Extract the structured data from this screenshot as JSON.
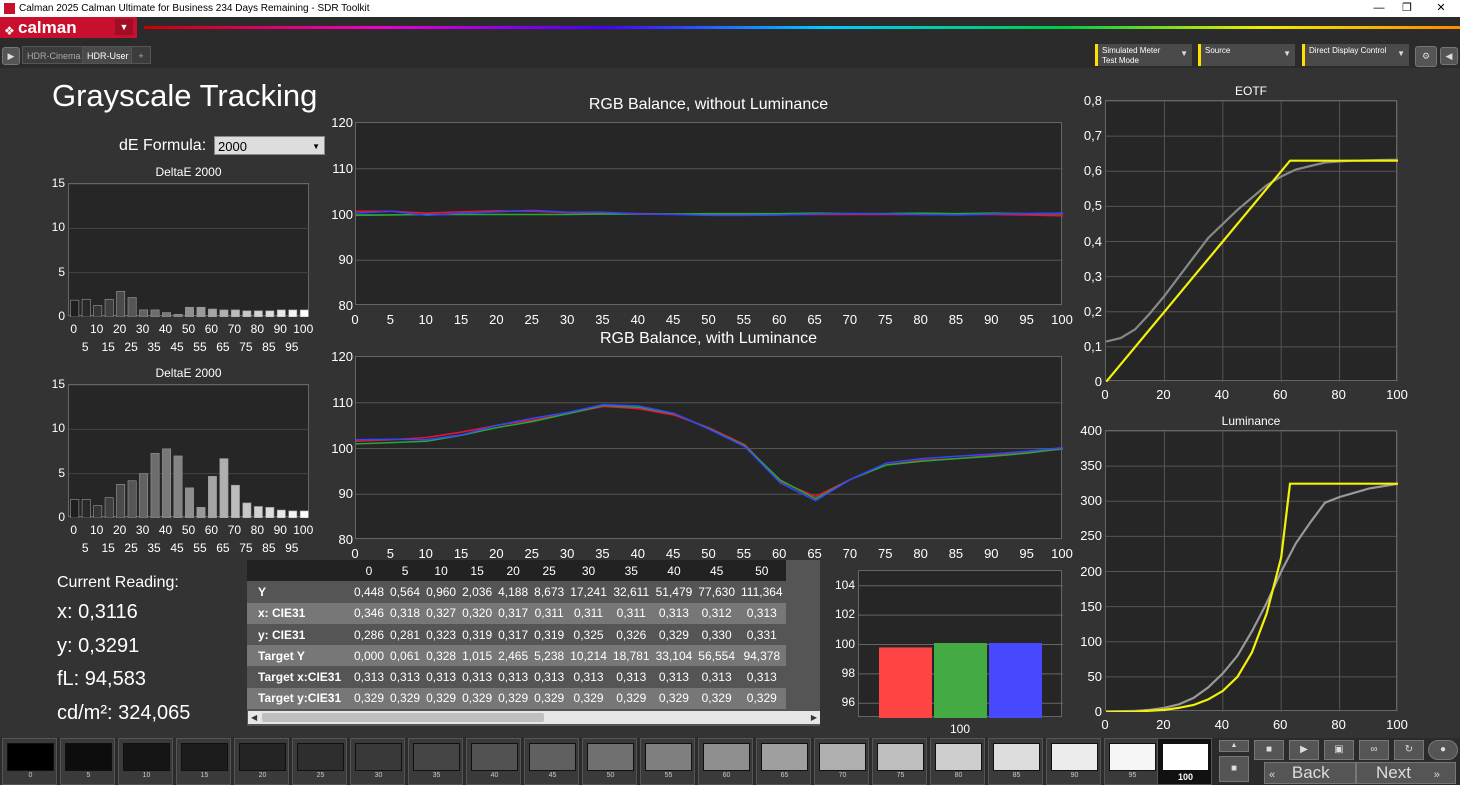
{
  "window": {
    "title": "Calman 2025 Calman Ultimate for Business 234 Days Remaining  - SDR Toolkit"
  },
  "brand": {
    "name": "calman"
  },
  "tabs": [
    {
      "label": "HDR-Cinema"
    },
    {
      "label": "HDR-User"
    },
    {
      "label": "+"
    }
  ],
  "toolbar": {
    "meter": {
      "line1": "Simulated Meter",
      "line2": "Test Mode"
    },
    "source": {
      "label": "Source"
    },
    "display": {
      "label": "Direct Display Control"
    }
  },
  "page": {
    "title": "Grayscale Tracking",
    "de_formula_label": "dE Formula:",
    "de_formula_value": "2000"
  },
  "reading": {
    "title": "Current Reading:",
    "x": "x: 0,3116",
    "y": "y: 0,3291",
    "fl": "fL: 94,583",
    "cdm2": "cd/m²: 324,065"
  },
  "chart_data": [
    {
      "type": "bar",
      "title": "DeltaE 2000",
      "x": [
        0,
        5,
        10,
        15,
        20,
        25,
        30,
        35,
        40,
        45,
        50,
        55,
        60,
        65,
        70,
        75,
        80,
        85,
        90,
        95,
        100
      ],
      "values": [
        1.9,
        2.0,
        1.3,
        2.0,
        2.9,
        2.2,
        0.8,
        0.8,
        0.5,
        0.3,
        1.1,
        1.1,
        0.9,
        0.8,
        0.8,
        0.7,
        0.7,
        0.7,
        0.8,
        0.8,
        0.8
      ],
      "ylim": [
        0,
        15
      ],
      "yticks": [
        0,
        5,
        10,
        15
      ],
      "xticks_top": [
        "0",
        "10",
        "20",
        "30",
        "40",
        "50",
        "60",
        "70",
        "80",
        "90",
        "100"
      ],
      "xticks_bottom": [
        "5",
        "15",
        "25",
        "35",
        "45",
        "55",
        "65",
        "75",
        "85",
        "95"
      ]
    },
    {
      "type": "bar",
      "title": "DeltaE 2000",
      "x": [
        0,
        5,
        10,
        15,
        20,
        25,
        30,
        35,
        40,
        45,
        50,
        55,
        60,
        65,
        70,
        75,
        80,
        85,
        90,
        95,
        100
      ],
      "values": [
        2.1,
        2.1,
        1.4,
        2.3,
        3.8,
        4.2,
        5.0,
        7.3,
        7.8,
        7.0,
        3.4,
        1.2,
        4.7,
        6.7,
        3.7,
        1.7,
        1.3,
        1.2,
        0.9,
        0.8,
        0.8
      ],
      "ylim": [
        0,
        15
      ],
      "yticks": [
        0,
        5,
        10,
        15
      ],
      "xticks_top": [
        "0",
        "10",
        "20",
        "30",
        "40",
        "50",
        "60",
        "70",
        "80",
        "90",
        "100"
      ],
      "xticks_bottom": [
        "5",
        "15",
        "25",
        "35",
        "45",
        "55",
        "65",
        "75",
        "85",
        "95"
      ]
    },
    {
      "type": "line",
      "title": "RGB Balance, without Luminance",
      "x": [
        0,
        5,
        10,
        15,
        20,
        25,
        30,
        35,
        40,
        45,
        50,
        55,
        60,
        65,
        70,
        75,
        80,
        85,
        90,
        95,
        100
      ],
      "series": [
        {
          "color": "#ee1133",
          "values": [
            100.7,
            100.7,
            100.3,
            100.6,
            100.8,
            100.7,
            100.4,
            100.4,
            100.2,
            100.1,
            100.0,
            100.0,
            100.0,
            100.0,
            100.0,
            100.0,
            100.0,
            100.0,
            100.0,
            99.9,
            99.7
          ]
        },
        {
          "color": "#22aa33",
          "values": [
            99.8,
            99.9,
            100.0,
            100.0,
            100.0,
            100.0,
            100.0,
            100.1,
            100.1,
            100.1,
            100.2,
            100.2,
            100.2,
            100.3,
            100.2,
            100.2,
            100.3,
            100.2,
            100.3,
            100.2,
            100.3
          ]
        },
        {
          "color": "#3344ff",
          "values": [
            100.3,
            100.7,
            99.8,
            100.3,
            100.6,
            100.9,
            100.5,
            100.5,
            100.1,
            100.0,
            99.8,
            99.8,
            99.9,
            100.1,
            100.2,
            100.1,
            100.0,
            99.9,
            100.1,
            100.2,
            100.3
          ]
        }
      ],
      "ylim": [
        80,
        120
      ],
      "yticks": [
        80,
        90,
        100,
        110,
        120
      ],
      "xlim": [
        0,
        100
      ]
    },
    {
      "type": "line",
      "title": "RGB Balance, with Luminance",
      "x": [
        0,
        5,
        10,
        15,
        20,
        25,
        30,
        35,
        40,
        45,
        50,
        55,
        60,
        65,
        70,
        75,
        80,
        85,
        90,
        95,
        100
      ],
      "series": [
        {
          "color": "#ee1133",
          "values": [
            101.6,
            101.9,
            102.4,
            103.6,
            105.1,
            106.2,
            107.6,
            109.2,
            108.7,
            107.3,
            104.5,
            100.8,
            92.8,
            89.5,
            93.3,
            96.4,
            97.4,
            97.8,
            98.5,
            99.1,
            99.9
          ]
        },
        {
          "color": "#22aa33",
          "values": [
            101.0,
            101.3,
            101.6,
            102.9,
            104.6,
            105.9,
            107.6,
            109.4,
            109.0,
            107.6,
            104.3,
            100.6,
            93.1,
            89.0,
            93.3,
            96.4,
            97.2,
            97.8,
            98.3,
            99.0,
            100.0
          ]
        },
        {
          "color": "#3344ff",
          "values": [
            101.9,
            102.0,
            101.9,
            103.0,
            105.1,
            106.6,
            107.9,
            109.6,
            109.3,
            107.7,
            104.2,
            100.4,
            92.5,
            88.6,
            93.3,
            96.8,
            97.8,
            98.3,
            98.8,
            99.4,
            100.2
          ]
        }
      ],
      "ylim": [
        80,
        120
      ],
      "yticks": [
        80,
        90,
        100,
        110,
        120
      ],
      "xlim": [
        0,
        100
      ]
    },
    {
      "type": "line",
      "title": "EOTF",
      "ylim": [
        0,
        0.8
      ],
      "xlim": [
        0,
        100
      ],
      "ytick_labels": [
        "0",
        "0,1",
        "0,2",
        "0,3",
        "0,4",
        "0,5",
        "0,6",
        "0,7",
        "0,8"
      ],
      "xticks": [
        0,
        20,
        40,
        60,
        80,
        100
      ],
      "series": [
        {
          "color": "#f2f20a",
          "x": [
            0,
            5,
            10,
            15,
            20,
            25,
            30,
            35,
            40,
            45,
            50,
            55,
            60,
            63,
            65,
            70,
            75,
            80,
            85,
            90,
            95,
            100
          ],
          "values": [
            0.0,
            0.05,
            0.1,
            0.15,
            0.2,
            0.25,
            0.3,
            0.35,
            0.4,
            0.45,
            0.5,
            0.55,
            0.6,
            0.63,
            0.63,
            0.63,
            0.63,
            0.63,
            0.63,
            0.63,
            0.63,
            0.63
          ]
        },
        {
          "color": "#888888",
          "x": [
            0,
            5,
            10,
            15,
            20,
            25,
            30,
            35,
            40,
            45,
            50,
            55,
            60,
            65,
            70,
            75,
            80,
            85,
            90,
            95,
            100
          ],
          "values": [
            0.115,
            0.125,
            0.15,
            0.195,
            0.245,
            0.3,
            0.355,
            0.41,
            0.45,
            0.49,
            0.525,
            0.56,
            0.585,
            0.605,
            0.615,
            0.625,
            0.628,
            0.63,
            0.631,
            0.632,
            0.633
          ]
        }
      ]
    },
    {
      "type": "line",
      "title": "Luminance",
      "ylim": [
        0,
        400
      ],
      "xlim": [
        0,
        100
      ],
      "yticks": [
        0,
        50,
        100,
        150,
        200,
        250,
        300,
        350,
        400
      ],
      "xticks": [
        0,
        20,
        40,
        60,
        80,
        100
      ],
      "series": [
        {
          "color": "#f2f20a",
          "x": [
            0,
            10,
            20,
            25,
            30,
            35,
            40,
            45,
            50,
            55,
            60,
            63,
            65,
            70,
            80,
            90,
            100
          ],
          "values": [
            0,
            0.5,
            3,
            6,
            10,
            18,
            30,
            50,
            85,
            140,
            220,
            325,
            325,
            325,
            325,
            325,
            325
          ]
        },
        {
          "color": "#999999",
          "x": [
            0,
            10,
            15,
            20,
            25,
            30,
            35,
            40,
            45,
            50,
            55,
            60,
            65,
            70,
            75,
            80,
            85,
            90,
            100
          ],
          "values": [
            0.5,
            1.5,
            3,
            6,
            11,
            20,
            35,
            55,
            80,
            115,
            155,
            200,
            240,
            270,
            298,
            306,
            312,
            318,
            325
          ]
        }
      ]
    },
    {
      "type": "bar",
      "ylim": [
        95,
        105
      ],
      "yticks": [
        96,
        98,
        100,
        102,
        104
      ],
      "categories": [
        "100"
      ],
      "series": [
        {
          "color": "#ff4444",
          "value": 99.8
        },
        {
          "color": "#44aa44",
          "value": 100.1
        },
        {
          "color": "#4848ff",
          "value": 100.1
        }
      ]
    }
  ],
  "table": {
    "columns": [
      "0",
      "5",
      "10",
      "15",
      "20",
      "25",
      "30",
      "35",
      "40",
      "45",
      "50"
    ],
    "rows": [
      {
        "label": "Y",
        "cells": [
          "0,448",
          "0,564",
          "0,960",
          "2,036",
          "4,188",
          "8,673",
          "17,241",
          "32,611",
          "51,479",
          "77,630",
          "111,364"
        ]
      },
      {
        "label": "x: CIE31",
        "cells": [
          "0,346",
          "0,318",
          "0,327",
          "0,320",
          "0,317",
          "0,311",
          "0,311",
          "0,311",
          "0,313",
          "0,312",
          "0,313"
        ]
      },
      {
        "label": "y: CIE31",
        "cells": [
          "0,286",
          "0,281",
          "0,323",
          "0,319",
          "0,317",
          "0,319",
          "0,325",
          "0,326",
          "0,329",
          "0,330",
          "0,331"
        ]
      },
      {
        "label": "Target Y",
        "cells": [
          "0,000",
          "0,061",
          "0,328",
          "1,015",
          "2,465",
          "5,238",
          "10,214",
          "18,781",
          "33,104",
          "56,554",
          "94,378"
        ]
      },
      {
        "label": "Target x:CIE31",
        "cells": [
          "0,313",
          "0,313",
          "0,313",
          "0,313",
          "0,313",
          "0,313",
          "0,313",
          "0,313",
          "0,313",
          "0,313",
          "0,313"
        ]
      },
      {
        "label": "Target y:CIE31",
        "cells": [
          "0,329",
          "0,329",
          "0,329",
          "0,329",
          "0,329",
          "0,329",
          "0,329",
          "0,329",
          "0,329",
          "0,329",
          "0,329"
        ]
      }
    ]
  },
  "patches": [
    {
      "label": "0",
      "color": "#000000"
    },
    {
      "label": "5",
      "color": "#0d0d0d"
    },
    {
      "label": "10",
      "color": "#151515"
    },
    {
      "label": "15",
      "color": "#1c1c1c"
    },
    {
      "label": "20",
      "color": "#242424"
    },
    {
      "label": "25",
      "color": "#2e2e2e"
    },
    {
      "label": "30",
      "color": "#393939"
    },
    {
      "label": "35",
      "color": "#454545"
    },
    {
      "label": "40",
      "color": "#525252"
    },
    {
      "label": "45",
      "color": "#606060"
    },
    {
      "label": "50",
      "color": "#707070"
    },
    {
      "label": "55",
      "color": "#7f7f7f"
    },
    {
      "label": "60",
      "color": "#8f8f8f"
    },
    {
      "label": "65",
      "color": "#9f9f9f"
    },
    {
      "label": "70",
      "color": "#afafaf"
    },
    {
      "label": "75",
      "color": "#bebebe"
    },
    {
      "label": "80",
      "color": "#cecece"
    },
    {
      "label": "85",
      "color": "#dddddd"
    },
    {
      "label": "90",
      "color": "#ececec"
    },
    {
      "label": "95",
      "color": "#f6f6f6"
    },
    {
      "label": "100",
      "color": "#ffffff"
    }
  ],
  "nav": {
    "back": "Back",
    "next": "Next"
  }
}
